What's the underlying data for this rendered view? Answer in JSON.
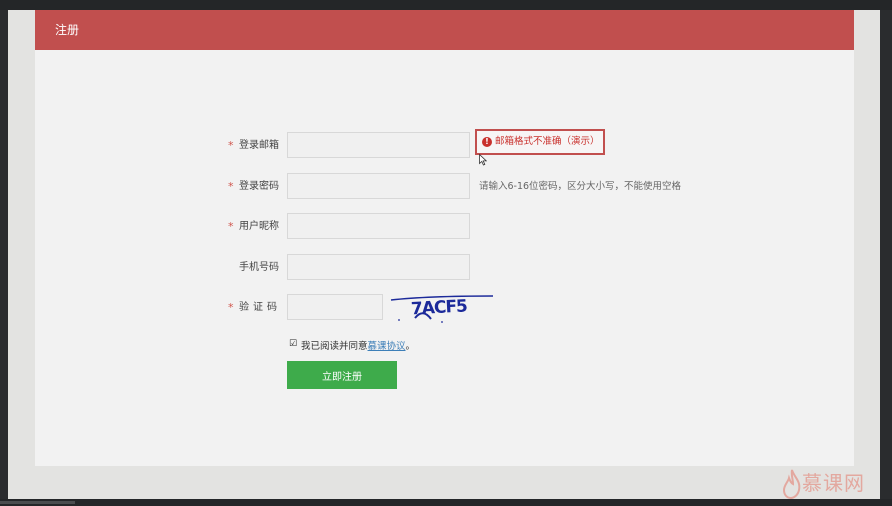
{
  "header": {
    "title": "注册"
  },
  "form": {
    "email": {
      "required_mark": "*",
      "label": "登录邮箱",
      "value": "",
      "error": "邮箱格式不准确（演示）"
    },
    "password": {
      "required_mark": "*",
      "label": "登录密码",
      "value": "",
      "hint": "请输入6-16位密码，区分大小写，不能使用空格"
    },
    "nickname": {
      "required_mark": "*",
      "label": "用户昵称",
      "value": ""
    },
    "phone": {
      "label": "手机号码",
      "value": ""
    },
    "captcha": {
      "required_mark": "*",
      "label": "验证码",
      "value": "",
      "image_text": "7ACF5"
    },
    "agreement": {
      "checked": true,
      "prefix": "我已阅读并同意",
      "link": "慕课协议",
      "suffix": "。"
    },
    "submit_label": "立即注册"
  },
  "watermark": {
    "text": "慕课网"
  },
  "colors": {
    "header": "#c14f4e",
    "submit": "#3eab4b",
    "error": "#c9302c",
    "link": "#3d7fb8"
  }
}
